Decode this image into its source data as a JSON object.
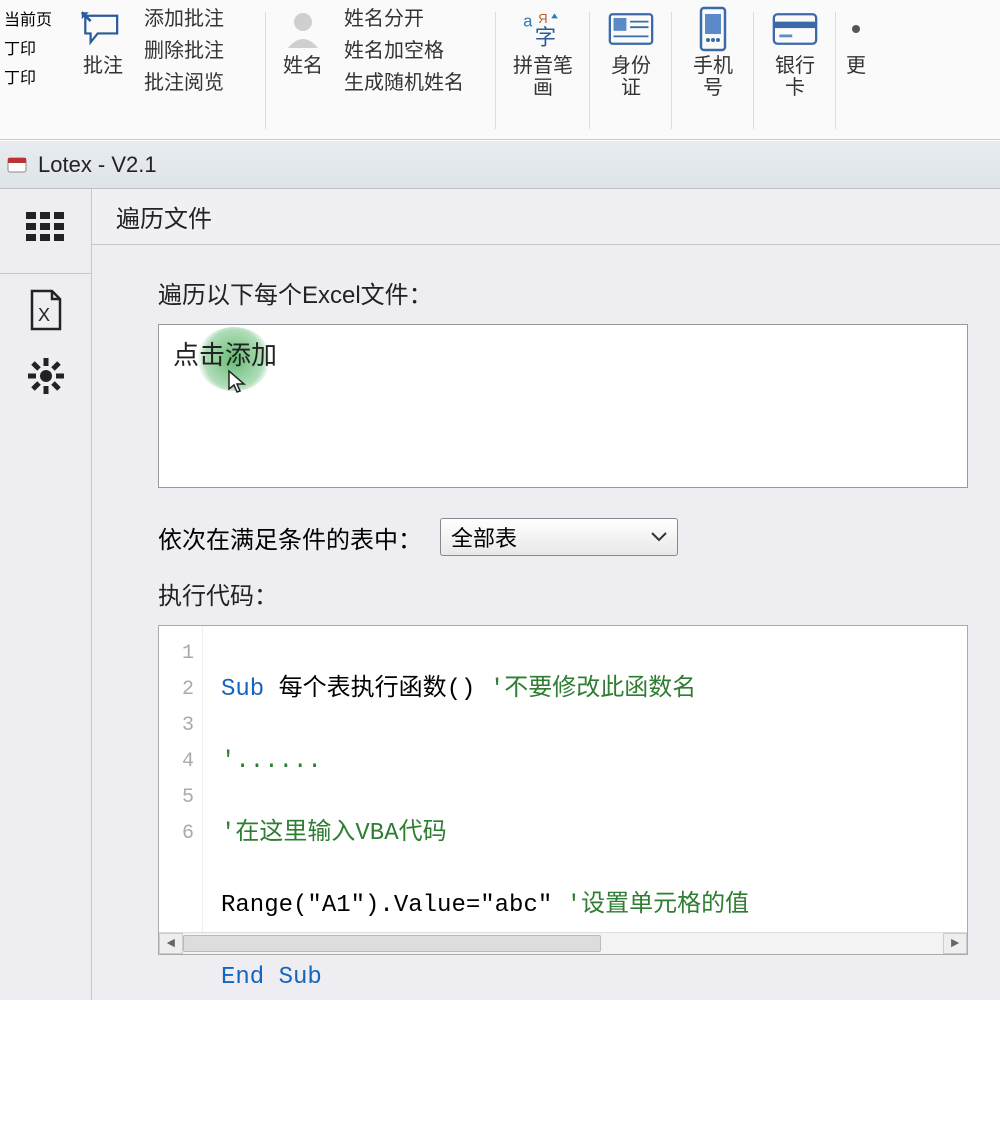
{
  "ribbon": {
    "left_col": [
      "当前页",
      "丁印",
      "丁印"
    ],
    "annot": {
      "label": "批注",
      "sub": [
        "添加批注",
        "删除批注",
        "批注阅览"
      ]
    },
    "name": {
      "label": "姓名",
      "sub": [
        "姓名分开",
        "姓名加空格",
        "生成随机姓名"
      ]
    },
    "py": {
      "label": "拼音笔\n画"
    },
    "id": {
      "label": "身份\n证"
    },
    "phone": {
      "label": "手机\n号"
    },
    "bank": {
      "label": "银行\n卡"
    },
    "more": {
      "label": "更"
    }
  },
  "titlebar": {
    "text": "Lotex - V2.1"
  },
  "tab": {
    "label": "遍历文件"
  },
  "form": {
    "files_label": "遍历以下每个Excel文件：",
    "add_hint": "点击添加",
    "cond_label": "依次在满足条件的表中：",
    "select_value": "全部表",
    "code_label": "执行代码："
  },
  "code": {
    "lines": [
      {
        "n": "1",
        "pre": "Sub ",
        "name": "每个表执行函数",
        "args": "()",
        "cm": " '不要修改此函数名"
      },
      {
        "n": "2",
        "cm_only": "'......"
      },
      {
        "n": "3",
        "cm_only": "'在这里输入VBA代码"
      },
      {
        "n": "4",
        "stmt": "Range(\"A1\").Value=\"abc\"",
        "cm": " '设置单元格的值"
      },
      {
        "n": "5",
        "end": "End Sub"
      },
      {
        "n": "6"
      }
    ]
  }
}
